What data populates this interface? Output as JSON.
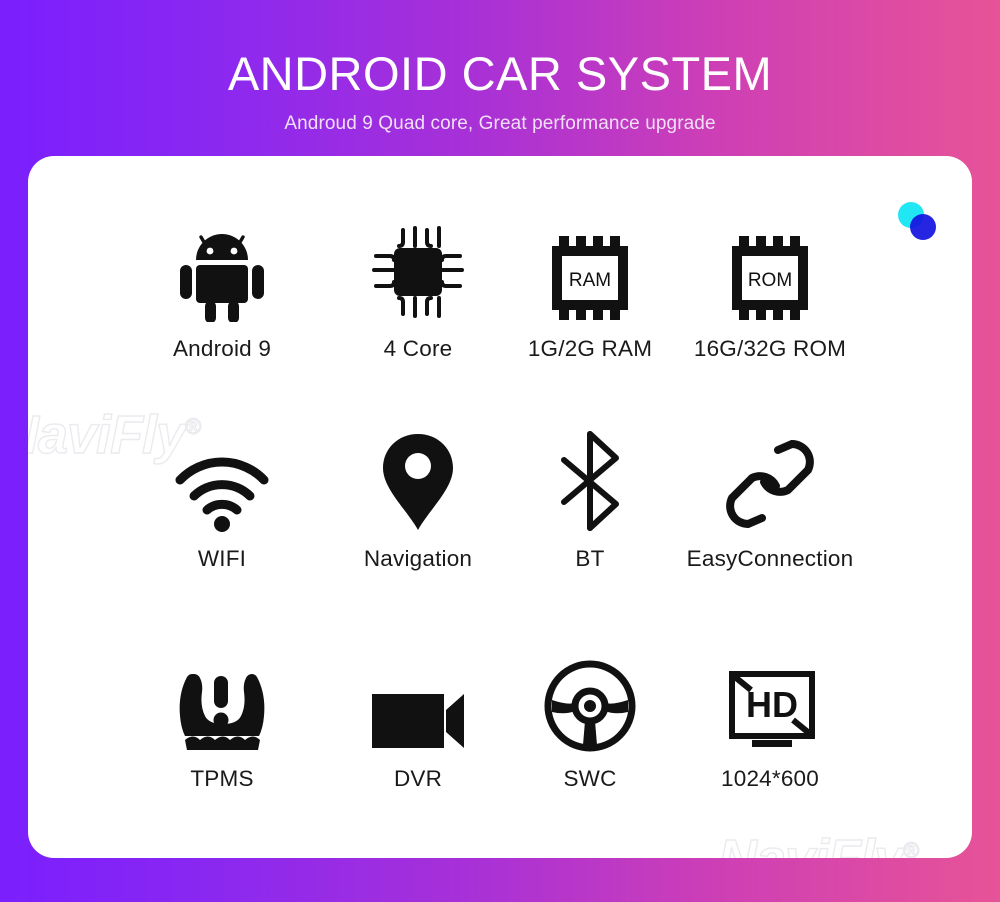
{
  "header": {
    "title": "ANDROID CAR SYSTEM",
    "subtitle": "Androud 9 Quad core,  Great performance upgrade"
  },
  "theme": {
    "gradient_start": "#7A1FFD",
    "gradient_end": "#E75397",
    "card_background": "#FFFFFF",
    "text_color": "#1A1A1A",
    "logo_cyan": "#21E6F3",
    "logo_blue": "#1414E0"
  },
  "card": {
    "logo": {
      "name": "overlapping-circles-logo"
    },
    "watermarks": [
      {
        "text": "NaviFly",
        "registered": "®"
      },
      {
        "text": "NaviFly",
        "registered": "®"
      }
    ],
    "features": [
      {
        "icon": "android-robot-icon",
        "label": "Android 9",
        "inner_text": ""
      },
      {
        "icon": "cpu-chip-icon",
        "label": "4 Core",
        "inner_text": ""
      },
      {
        "icon": "ram-chip-icon",
        "label": "1G/2G RAM",
        "inner_text": "RAM"
      },
      {
        "icon": "rom-chip-icon",
        "label": "16G/32G ROM",
        "inner_text": "ROM"
      },
      {
        "icon": "wifi-icon",
        "label": "WIFI",
        "inner_text": ""
      },
      {
        "icon": "map-pin-icon",
        "label": "Navigation",
        "inner_text": ""
      },
      {
        "icon": "bluetooth-icon",
        "label": "BT",
        "inner_text": ""
      },
      {
        "icon": "chain-link-icon",
        "label": "EasyConnection",
        "inner_text": ""
      },
      {
        "icon": "tire-pressure-warning-icon",
        "label": "TPMS",
        "inner_text": ""
      },
      {
        "icon": "video-camera-icon",
        "label": "DVR",
        "inner_text": ""
      },
      {
        "icon": "steering-wheel-icon",
        "label": "SWC",
        "inner_text": ""
      },
      {
        "icon": "hd-monitor-icon",
        "label": "1024*600",
        "inner_text": "HD"
      }
    ]
  }
}
